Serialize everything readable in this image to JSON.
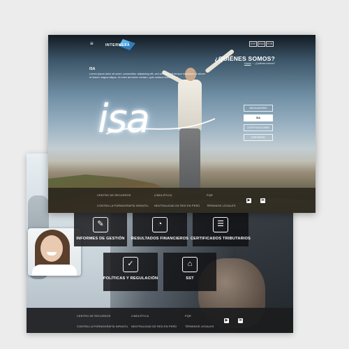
{
  "back": {
    "tiles": [
      {
        "label": "INFORMES DE GESTIÓN",
        "icon": "report-icon"
      },
      {
        "label": "RESULTADOS FINANCIEROS",
        "icon": "chart-monitor-icon"
      },
      {
        "label": "CERTIFICADOS TRIBUTARIOS",
        "icon": "certificate-icon"
      },
      {
        "label": "POLÍTICAS Y REGULACIÓN",
        "icon": "policy-document-icon"
      },
      {
        "label": "SST",
        "icon": "lock-icon"
      }
    ],
    "footer": {
      "links": [
        "CENTRO DE RECURSOS",
        "LÍNEA ÉTICA",
        "PQR",
        "CONTRA LA PORNOGRAFÍA INFANTIL",
        "NEUTRALIDAD DE RED EN PERÚ",
        "TÉRMINOS LEGALES"
      ],
      "social": [
        "youtube-icon",
        "linkedin-icon"
      ]
    }
  },
  "front": {
    "logo": "INTERNEXA",
    "languages": [
      "ESP",
      "ENG",
      "POR"
    ],
    "heading": "¿QUIÉNES SOMOS?",
    "breadcrumb": {
      "home": "Home",
      "current": "¿Quiénes somos?"
    },
    "section_title": "ISA",
    "section_text": "Lorem ipsum dolor sit amet, consectetur adipiscing elit, sed do eiusmod tempor incididunt ut labore et dolore magna aliqua. Ut enim ad minim veniam, quis nostrud exercitation.",
    "brand_word": "isa",
    "side_nav": [
      {
        "label": "INDICADORES",
        "active": false
      },
      {
        "label": "ISA",
        "active": true
      },
      {
        "label": "CERTIFICACIONES",
        "active": false
      },
      {
        "label": "PARTNERS",
        "active": false
      }
    ],
    "footer": {
      "links": [
        "CENTRO DE RECURSOS",
        "LÍNEA ÉTICA",
        "PQR",
        "CONTRA LA PORNOGRAFÍA INFANTIL",
        "NEUTRALIDAD DE RED EN PERÚ",
        "TÉRMINOS LEGALES"
      ],
      "social": [
        "youtube-icon",
        "linkedin-icon"
      ]
    }
  }
}
